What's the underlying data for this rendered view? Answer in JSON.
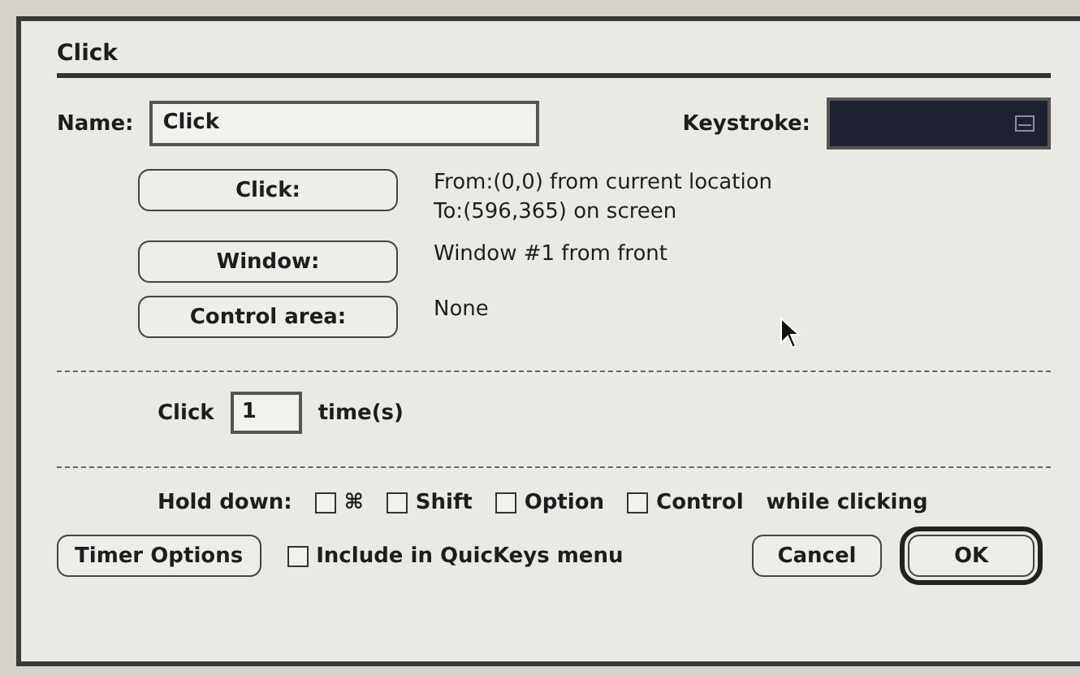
{
  "dialog": {
    "title": "Click",
    "name": {
      "label": "Name:",
      "value": "Click"
    },
    "keystroke": {
      "label": "Keystroke:"
    },
    "actions": [
      {
        "button": "Click:",
        "description": [
          "From:(0,0) from current location",
          "To:(596,365) on screen"
        ]
      },
      {
        "button": "Window:",
        "description": [
          "Window #1 from front"
        ]
      },
      {
        "button": "Control area:",
        "description": [
          "None"
        ]
      }
    ],
    "repeat": {
      "label": "Click",
      "value": "1",
      "suffix": "time(s)"
    },
    "hold_down": {
      "label": "Hold down:",
      "keys": [
        {
          "label": "⌘",
          "checked": false
        },
        {
          "label": "Shift",
          "checked": false
        },
        {
          "label": "Option",
          "checked": false
        },
        {
          "label": "Control",
          "checked": false
        }
      ],
      "suffix": "while clicking"
    },
    "timer_button": "Timer Options",
    "include_in_menu": {
      "label": "Include in QuicKeys menu",
      "checked": false
    },
    "buttons": [
      {
        "label": "Cancel",
        "default": false
      },
      {
        "label": "OK",
        "default": true
      }
    ]
  }
}
